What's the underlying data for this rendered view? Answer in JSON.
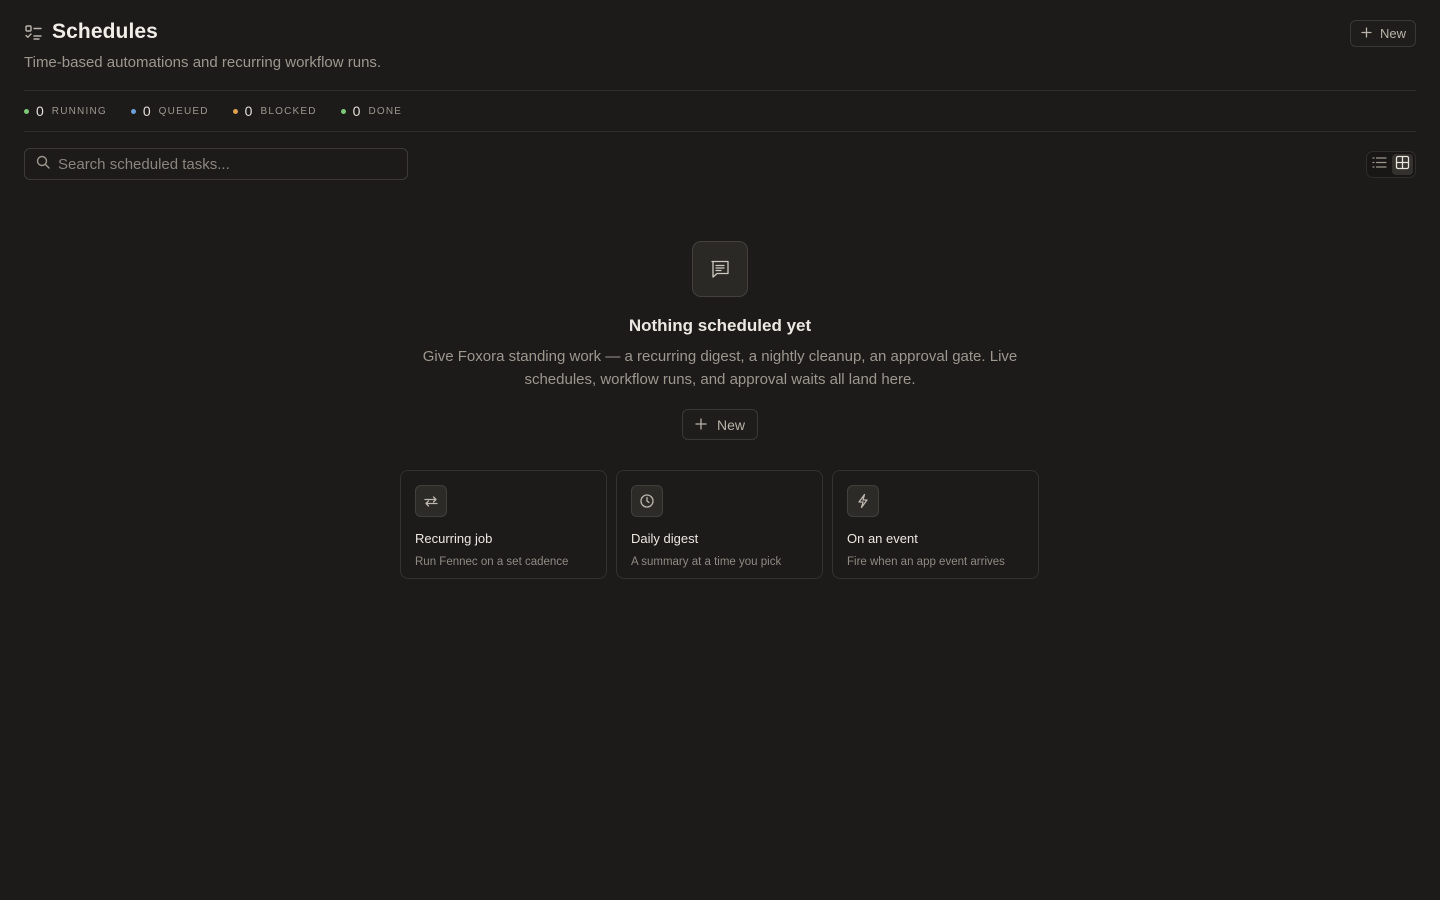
{
  "header": {
    "title": "Schedules",
    "subtitle": "Time-based automations and recurring workflow runs.",
    "new_label": "New",
    "title_icon": "list-checks-icon"
  },
  "stats": [
    {
      "count": "0",
      "label": "RUNNING",
      "color": "#7ec87a"
    },
    {
      "count": "0",
      "label": "QUEUED",
      "color": "#6f9fd8"
    },
    {
      "count": "0",
      "label": "BLOCKED",
      "color": "#e0a24e"
    },
    {
      "count": "0",
      "label": "DONE",
      "color": "#7ec87a"
    }
  ],
  "search": {
    "placeholder": "Search scheduled tasks..."
  },
  "view_toggle": {
    "options": [
      "list-view-icon",
      "grid-view-icon"
    ],
    "active": "grid-view-icon"
  },
  "empty_state": {
    "icon": "message-lines-icon",
    "title": "Nothing scheduled yet",
    "description": "Give Foxora standing work — a recurring digest, a nightly cleanup, an approval gate. Live schedules, workflow runs, and approval waits all land here.",
    "new_label": "New"
  },
  "templates": [
    {
      "icon": "repeat-icon",
      "title": "Recurring job",
      "description": "Run Fennec on a set cadence"
    },
    {
      "icon": "clock-icon",
      "title": "Daily digest",
      "description": "A summary at a time you pick"
    },
    {
      "icon": "lightning-icon",
      "title": "On an event",
      "description": "Fire when an app event arrives"
    }
  ]
}
